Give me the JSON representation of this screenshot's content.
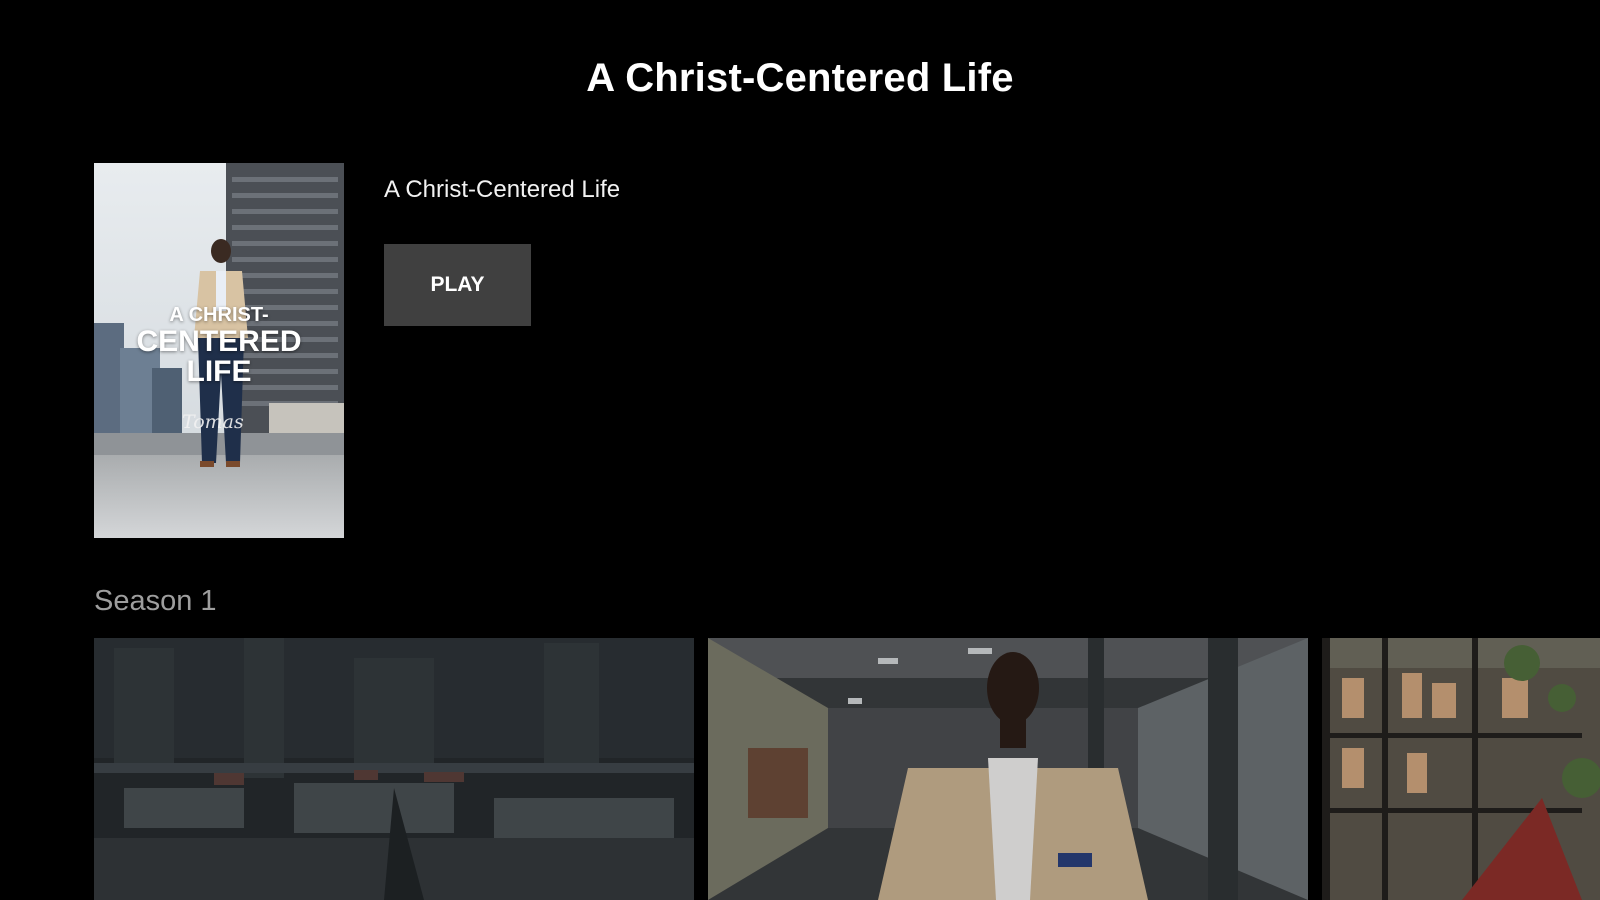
{
  "header": {
    "title": "A Christ-Centered Life"
  },
  "show": {
    "title": "A Christ-Centered Life",
    "play_label": "PLAY",
    "poster": {
      "line1": "A CHRIST-",
      "line2": "CENTERED",
      "line3": "LIFE",
      "signature": "Tomas"
    }
  },
  "season": {
    "label": "Season 1"
  },
  "episodes": [
    {
      "thumbnail": "city-rooftop-overcast"
    },
    {
      "thumbnail": "man-in-hallway"
    },
    {
      "thumbnail": "shelves-with-plants"
    }
  ],
  "colors": {
    "background": "#000000",
    "play_button": "#404040",
    "season_label": "#9e9e9e"
  }
}
